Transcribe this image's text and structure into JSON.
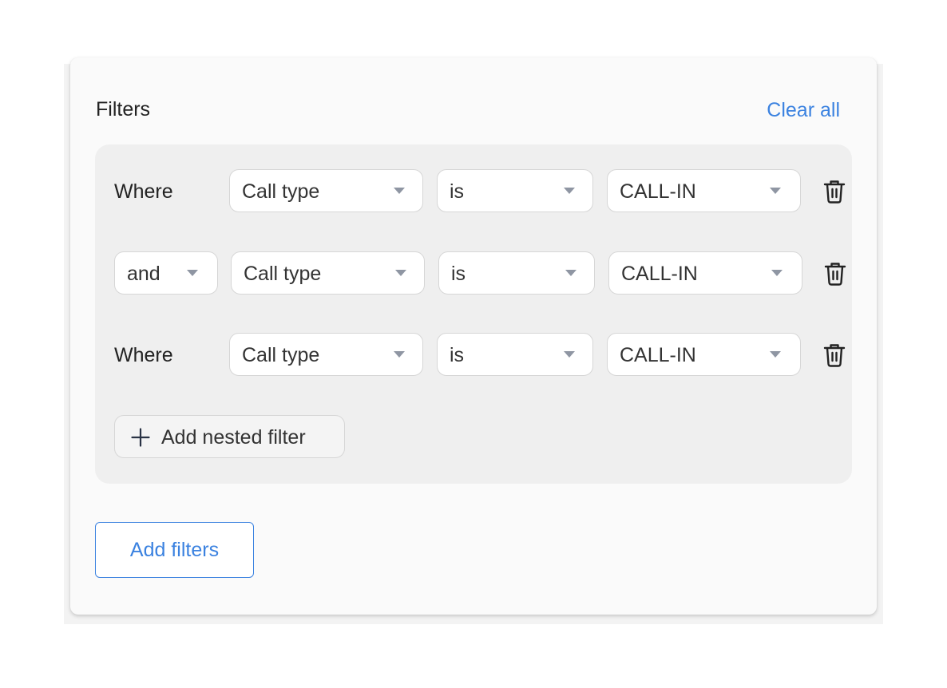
{
  "header": {
    "title": "Filters",
    "clear_all": "Clear all"
  },
  "filters": [
    {
      "connector": "Where",
      "field": "Call type",
      "operator": "is",
      "value": "CALL-IN"
    },
    {
      "connector": "and",
      "field": "Call type",
      "operator": "is",
      "value": "CALL-IN"
    },
    {
      "connector": "Where",
      "field": "Call type",
      "operator": "is",
      "value": "CALL-IN"
    }
  ],
  "nested": {
    "add_label": "Add nested filter"
  },
  "footer": {
    "add_filters_label": "Add filters"
  },
  "colors": {
    "accent": "#3b82e0",
    "group_bg": "#efefef",
    "caret": "#8f96a3"
  }
}
